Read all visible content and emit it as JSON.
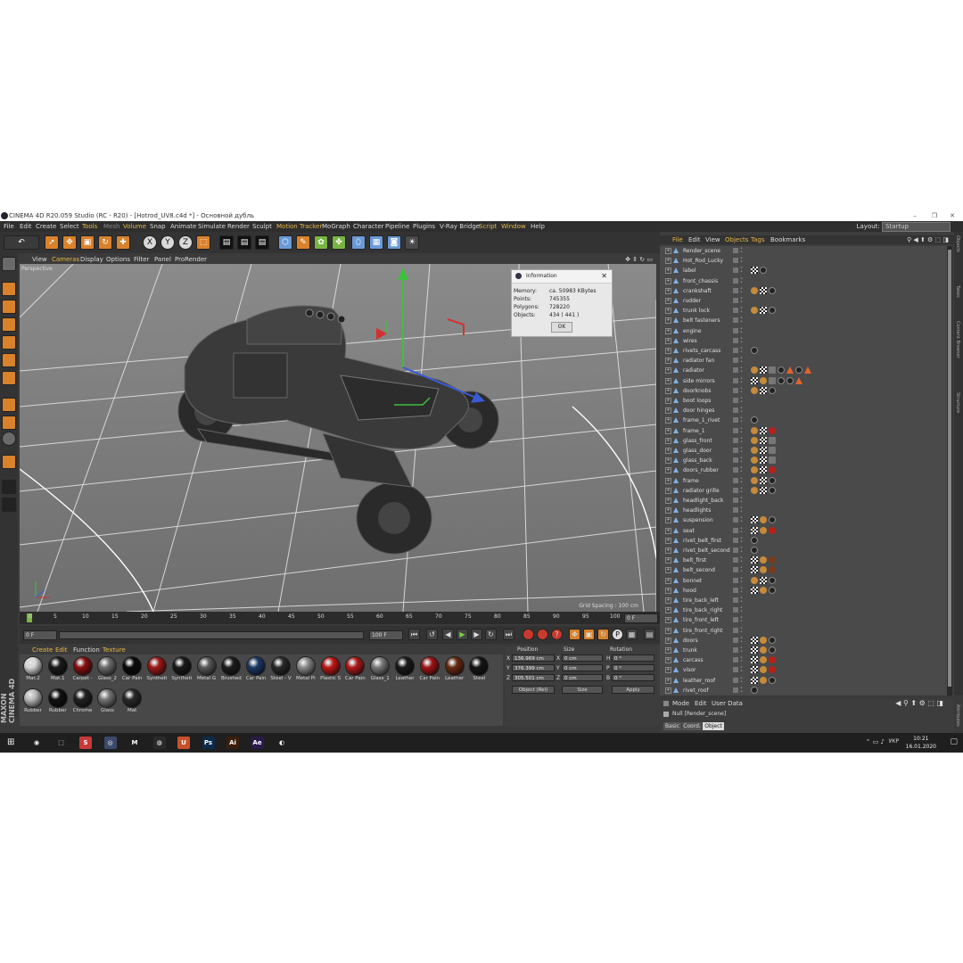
{
  "window": {
    "title": "CINEMA 4D R20.059 Studio (RC - R20) - [Hotrod_UV8.c4d *] - Основной дубль",
    "controls": [
      "–",
      "❐",
      "✕"
    ]
  },
  "menubar": {
    "items": [
      "File",
      "Edit",
      "Create",
      "Select",
      "Tools",
      "Mesh",
      "Volume",
      "Snap",
      "Animate",
      "Simulate",
      "Render",
      "Sculpt",
      "Motion Tracker",
      "MoGraph",
      "Character",
      "Pipeline",
      "Plugins",
      "V-Ray Bridge",
      "Script",
      "Window",
      "Help"
    ],
    "layout_label": "Layout:",
    "layout_value": "Startup"
  },
  "viewport": {
    "menu": [
      "View",
      "Cameras",
      "Display",
      "Options",
      "Filter",
      "Panel",
      "ProRender"
    ],
    "camera_label": "Perspective",
    "grid_spacing": "Grid Spacing : 100 cm"
  },
  "info_dialog": {
    "title": "Information",
    "rows": [
      {
        "label": "Memory:",
        "value": "ca. 50983 KBytes"
      },
      {
        "label": "Points:",
        "value": "745355"
      },
      {
        "label": "Polygons:",
        "value": "728220"
      },
      {
        "label": "Objects:",
        "value": "434 ( 441 )"
      }
    ],
    "ok": "OK"
  },
  "timeline": {
    "ticks": [
      "0",
      "5",
      "10",
      "15",
      "20",
      "25",
      "30",
      "35",
      "40",
      "45",
      "50",
      "55",
      "60",
      "65",
      "70",
      "75",
      "80",
      "85",
      "90",
      "95",
      "100"
    ],
    "end_field": "0 F",
    "current_frame": "0 F",
    "min_frame": "0 F",
    "max_frame": "100 F",
    "max_frame2": "100 F"
  },
  "material_manager": {
    "menu": [
      "Create",
      "Edit",
      "Function",
      "Texture"
    ],
    "materials": [
      {
        "name": "Mat.2",
        "color": "#d9d9d9"
      },
      {
        "name": "Mat.1",
        "color": "#1a1a1a"
      },
      {
        "name": "Carpet -",
        "color": "#8a1010"
      },
      {
        "name": "Glass_2",
        "color": "#6e6e6e"
      },
      {
        "name": "Car Pain",
        "color": "#0a0a0a"
      },
      {
        "name": "Syntheti",
        "color": "#a01818"
      },
      {
        "name": "Syntheti",
        "color": "#1a1a1a"
      },
      {
        "name": "Metal G",
        "color": "#5a5a5a"
      },
      {
        "name": "Brushed",
        "color": "#1c1c1c"
      },
      {
        "name": "Car Pain",
        "color": "#1c3a66"
      },
      {
        "name": "Steel - V",
        "color": "#2a2a2a"
      },
      {
        "name": "Metal Pi",
        "color": "#8a8a8a"
      },
      {
        "name": "Plastic S",
        "color": "#c01818"
      },
      {
        "name": "Car Pain",
        "color": "#b01a1a"
      },
      {
        "name": "Glass_1",
        "color": "#7a7a7a"
      },
      {
        "name": "Leather",
        "color": "#1a1a1a"
      },
      {
        "name": "Car Pain",
        "color": "#a01414"
      },
      {
        "name": "Leather",
        "color": "#6a2a10"
      },
      {
        "name": "Steel",
        "color": "#151515"
      },
      {
        "name": "Rubber",
        "color": "#bdbdbd"
      },
      {
        "name": "Rubber",
        "color": "#111111"
      },
      {
        "name": "Chrome",
        "color": "#222222"
      },
      {
        "name": "Glass",
        "color": "#777777"
      },
      {
        "name": "Mat",
        "color": "#2a2a2a"
      }
    ],
    "brand": "MAXON CINEMA 4D"
  },
  "coordinates": {
    "headers": [
      "Position",
      "Size",
      "Rotation"
    ],
    "rows": [
      {
        "axis": "X",
        "pos": "136.969 cm",
        "saxis": "X",
        "size": "0 cm",
        "raxis": "H",
        "rot": "0 °"
      },
      {
        "axis": "Y",
        "pos": "376.399 cm",
        "saxis": "Y",
        "size": "0 cm",
        "raxis": "P",
        "rot": "0 °"
      },
      {
        "axis": "Z",
        "pos": "305.501 cm",
        "saxis": "Z",
        "size": "0 cm",
        "raxis": "B",
        "rot": "0 °"
      }
    ],
    "mode_select": "Object (Rel)",
    "size_select": "Size",
    "apply": "Apply"
  },
  "object_manager": {
    "menu": [
      "File",
      "Edit",
      "View",
      "Objects",
      "Tags",
      "Bookmarks"
    ],
    "rows": [
      {
        "name": "Render_scene",
        "tags": []
      },
      {
        "name": "Hot_Rod_Lucky",
        "tags": []
      },
      {
        "name": "label",
        "tags": [
          "c",
          "m"
        ]
      },
      {
        "name": "front_chassis",
        "tags": []
      },
      {
        "name": "crankshaft",
        "tags": [
          "p",
          "c",
          "m"
        ]
      },
      {
        "name": "rudder",
        "tags": []
      },
      {
        "name": "trunk lock",
        "tags": [
          "p",
          "c",
          "m"
        ]
      },
      {
        "name": "belt fasteners",
        "tags": []
      },
      {
        "name": "engine",
        "tags": []
      },
      {
        "name": "wires",
        "tags": []
      },
      {
        "name": "rivets_carcass",
        "tags": [
          "m"
        ]
      },
      {
        "name": "radiator fan",
        "tags": []
      },
      {
        "name": "radiator",
        "tags": [
          "p",
          "c",
          "s",
          "m",
          "w",
          "m",
          "w"
        ]
      },
      {
        "name": "side mirrors",
        "tags": [
          "c",
          "p",
          "s",
          "m",
          "m",
          "w"
        ]
      },
      {
        "name": "doorknobs",
        "tags": [
          "p",
          "c",
          "m"
        ]
      },
      {
        "name": "boot loops",
        "tags": []
      },
      {
        "name": "door hinges",
        "tags": []
      },
      {
        "name": "frame_1_rivet",
        "tags": [
          "m"
        ]
      },
      {
        "name": "frame_1",
        "tags": [
          "p",
          "c",
          "r"
        ]
      },
      {
        "name": "glass_front",
        "tags": [
          "p",
          "c",
          "s"
        ]
      },
      {
        "name": "glass_door",
        "tags": [
          "p",
          "c",
          "s"
        ]
      },
      {
        "name": "glass_back",
        "tags": [
          "p",
          "c",
          "s"
        ]
      },
      {
        "name": "doors_rubber",
        "tags": [
          "p",
          "c",
          "r"
        ]
      },
      {
        "name": "frame",
        "tags": [
          "p",
          "c",
          "m"
        ]
      },
      {
        "name": "radiator grille",
        "tags": [
          "p",
          "c",
          "m"
        ]
      },
      {
        "name": "headlight_back",
        "tags": []
      },
      {
        "name": "headlights",
        "tags": []
      },
      {
        "name": "suspension",
        "tags": [
          "c",
          "p",
          "m"
        ]
      },
      {
        "name": "seat",
        "tags": [
          "c",
          "p",
          "r"
        ]
      },
      {
        "name": "rivet_belt_first",
        "tags": [
          "m"
        ]
      },
      {
        "name": "rivet_belt_second",
        "tags": [
          "m"
        ]
      },
      {
        "name": "belt_first",
        "tags": [
          "c",
          "p",
          "br"
        ]
      },
      {
        "name": "belt_second",
        "tags": [
          "c",
          "p",
          "br"
        ]
      },
      {
        "name": "bonnet",
        "tags": [
          "p",
          "c",
          "m"
        ]
      },
      {
        "name": "hood",
        "tags": [
          "c",
          "p",
          "m"
        ]
      },
      {
        "name": "tire_back_left",
        "tags": []
      },
      {
        "name": "tire_back_right",
        "tags": []
      },
      {
        "name": "tire_front_left",
        "tags": []
      },
      {
        "name": "tire_front_right",
        "tags": []
      },
      {
        "name": "doors",
        "tags": [
          "c",
          "p",
          "m"
        ]
      },
      {
        "name": "trunk",
        "tags": [
          "c",
          "p",
          "m"
        ]
      },
      {
        "name": "carcass",
        "tags": [
          "c",
          "p",
          "r"
        ]
      },
      {
        "name": "visor",
        "tags": [
          "c",
          "p",
          "r"
        ]
      },
      {
        "name": "leather_roof",
        "tags": [
          "c",
          "p",
          "m"
        ]
      },
      {
        "name": "rivet_roof",
        "tags": [
          "m"
        ]
      }
    ],
    "right_tabs": [
      "Objects",
      "Takes",
      "Content Browser",
      "Structure"
    ]
  },
  "attribute_manager": {
    "menu": [
      "Mode",
      "Edit",
      "User Data"
    ],
    "object_label": "Null [Render_scene]",
    "tabs": [
      "Basic",
      "Coord.",
      "Object"
    ],
    "right_tab": "Attributes"
  },
  "taskbar": {
    "apps": [
      {
        "label": "◉",
        "color": "#1f1f1f"
      },
      {
        "label": "⬚",
        "color": "#1f1f1f"
      },
      {
        "label": "S",
        "color": "#c73a3a"
      },
      {
        "label": "◎",
        "color": "#3a4a6a"
      },
      {
        "label": "M",
        "color": "#1f1f1f"
      },
      {
        "label": "◍",
        "color": "#2a2a2a"
      },
      {
        "label": "U",
        "color": "#c8512a"
      },
      {
        "label": "Ps",
        "color": "#0c2a4a"
      },
      {
        "label": "Ai",
        "color": "#3a1f0a"
      },
      {
        "label": "Ae",
        "color": "#2a1a4a"
      },
      {
        "label": "◐",
        "color": "#1f1f1f"
      }
    ],
    "lang": "УКР",
    "time": "10:21",
    "date": "16.01.2020"
  },
  "colors": {
    "accent_orange": "#d9822b",
    "menu_highlight": "#e8b84a",
    "axis_y": "#3fbf3f",
    "axis_x": "#d53030",
    "axis_z": "#3a5ad6"
  }
}
